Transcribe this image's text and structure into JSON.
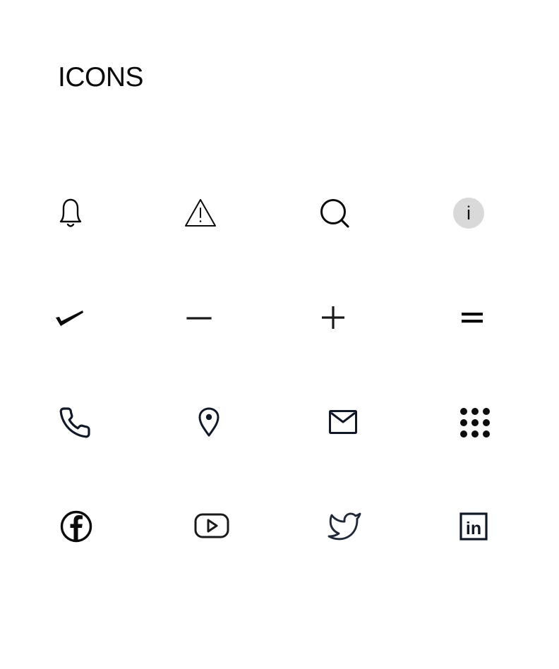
{
  "page": {
    "title": "ICONS"
  },
  "icons": [
    {
      "name": "bell-icon",
      "row": 1
    },
    {
      "name": "warning-triangle-icon",
      "row": 1
    },
    {
      "name": "search-icon",
      "row": 1
    },
    {
      "name": "info-icon",
      "row": 1,
      "glyph": "i"
    },
    {
      "name": "checkmark-icon",
      "row": 2
    },
    {
      "name": "minus-icon",
      "row": 2
    },
    {
      "name": "plus-icon",
      "row": 2
    },
    {
      "name": "equals-icon",
      "row": 2
    },
    {
      "name": "phone-icon",
      "row": 3
    },
    {
      "name": "location-pin-icon",
      "row": 3
    },
    {
      "name": "mail-icon",
      "row": 3
    },
    {
      "name": "dialpad-icon",
      "row": 3
    },
    {
      "name": "facebook-icon",
      "row": 4
    },
    {
      "name": "youtube-icon",
      "row": 4
    },
    {
      "name": "twitter-icon",
      "row": 4
    },
    {
      "name": "linkedin-icon",
      "row": 4,
      "glyph": "in"
    }
  ],
  "colors": {
    "ink": "#0b0b0b",
    "navy": "#111827",
    "info_fill": "#d9d9d9",
    "background": "#ffffff"
  }
}
